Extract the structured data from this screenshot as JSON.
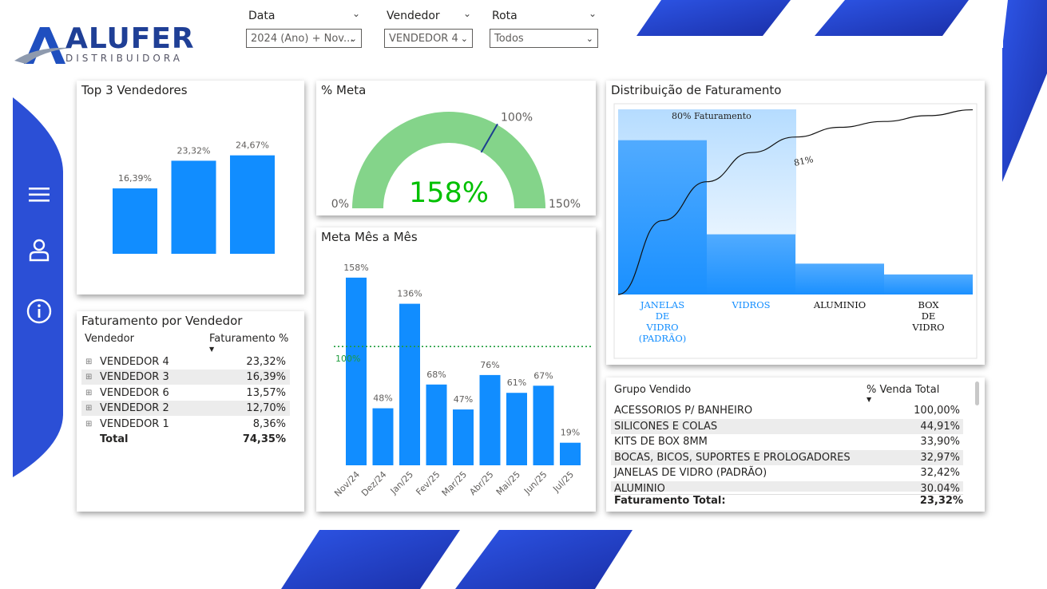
{
  "brand": {
    "name": "ALUFER",
    "tagline": "DISTRIBUIDORA"
  },
  "colors": {
    "accent": "#118dff",
    "navy": "#1e3a8a",
    "gauge_fill": "#84d48a",
    "gauge_value": "#00c000",
    "target_line": "#1f9c3c"
  },
  "filters": [
    {
      "label": "Data",
      "value": "2024 (Ano) + Nov..."
    },
    {
      "label": "Vendedor",
      "value": "VENDEDOR 4"
    },
    {
      "label": "Rota",
      "value": "Todos"
    }
  ],
  "nav": {
    "items": [
      "menu-icon",
      "user-icon",
      "info-icon"
    ]
  },
  "top3": {
    "title": "Top 3 Vendedores",
    "chart_data": {
      "type": "bar",
      "categories": [
        "",
        "",
        ""
      ],
      "values": [
        16.39,
        23.32,
        24.67
      ],
      "labels": [
        "16,39%",
        "23,32%",
        "24,67%"
      ],
      "ylim": [
        0,
        30
      ]
    }
  },
  "meta_gauge": {
    "title": "% Meta",
    "value_label": "158%",
    "min_label": "0%",
    "max_label": "150%",
    "target_label": "100%",
    "chart_data": {
      "type": "gauge",
      "value": 158,
      "min": 0,
      "max": 150,
      "target": 100
    }
  },
  "meta_mes": {
    "title": "Meta Mês a Mês",
    "target_label": "100%",
    "chart_data": {
      "type": "bar",
      "categories": [
        "Nov/24",
        "Dez/24",
        "Jan/25",
        "Fev/25",
        "Mar/25",
        "Abr/25",
        "Mai/25",
        "Jun/25",
        "Jul/25"
      ],
      "values": [
        158,
        48,
        136,
        68,
        47,
        76,
        61,
        67,
        19
      ],
      "labels": [
        "158%",
        "48%",
        "136%",
        "68%",
        "47%",
        "76%",
        "61%",
        "67%",
        "19%"
      ],
      "target": 100,
      "ylim": [
        0,
        170
      ]
    }
  },
  "distribuicao": {
    "title": "Distribuição de Faturamento",
    "band_label": "80% Faturamento",
    "curve_label": "81%",
    "chart_data": {
      "type": "bar",
      "categories": [
        "JANELAS DE VIDRO (PADRÃO)",
        "VIDROS",
        "ALUMINIO",
        "BOX DE VIDRO"
      ],
      "category_lines": [
        [
          "JANELAS",
          "DE",
          "VIDRO",
          "(PADRÃO)"
        ],
        [
          "VIDROS"
        ],
        [
          "ALUMINIO"
        ],
        [
          "BOX",
          "DE",
          "VIDRO"
        ]
      ],
      "values": [
        50,
        19.5,
        10,
        6.5
      ],
      "cumulative_percent": [
        0,
        38,
        58,
        73,
        81,
        86,
        89,
        92,
        95
      ],
      "ylim": [
        0,
        60
      ]
    }
  },
  "faturamento_vendedor": {
    "title": "Faturamento por Vendedor",
    "columns": [
      "Vendedor",
      "Faturamento %"
    ],
    "rows": [
      {
        "name": "VENDEDOR 4",
        "value": "23,32%"
      },
      {
        "name": "VENDEDOR 3",
        "value": "16,39%"
      },
      {
        "name": "VENDEDOR 6",
        "value": "13,57%"
      },
      {
        "name": "VENDEDOR 2",
        "value": "12,70%"
      },
      {
        "name": "VENDEDOR 1",
        "value": "8,36%"
      }
    ],
    "total_label": "Total",
    "total_value": "74,35%"
  },
  "grupo_vendido": {
    "columns": [
      "Grupo Vendido",
      "% Venda Total"
    ],
    "rows": [
      {
        "name": "ACESSORIOS P/ BANHEIRO",
        "value": "100,00%"
      },
      {
        "name": "SILICONES E COLAS",
        "value": "44,91%"
      },
      {
        "name": "KITS DE BOX 8MM",
        "value": "33,90%"
      },
      {
        "name": "BOCAS, BICOS, SUPORTES E PROLOGADORES",
        "value": "32,97%"
      },
      {
        "name": "JANELAS DE VIDRO (PADRÃO)",
        "value": "32,42%"
      },
      {
        "name": "ALUMINIO",
        "value": "30,04%"
      }
    ],
    "total_label": "Faturamento Total:",
    "total_value": "23,32%"
  }
}
